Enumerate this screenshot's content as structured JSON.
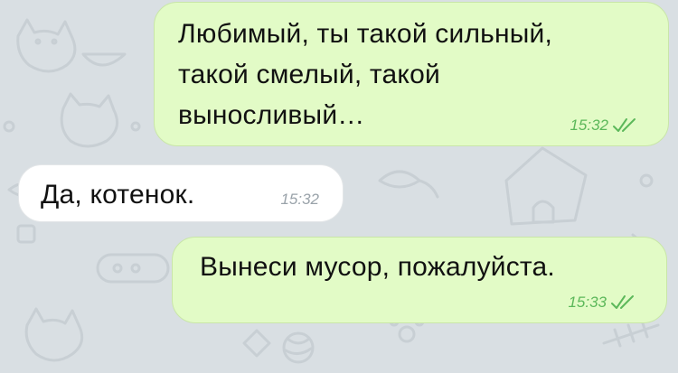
{
  "messages": [
    {
      "direction": "outgoing",
      "text": "Любимый, ты такой сильный,\nтакой смелый, такой\nвыносливый…",
      "time": "15:32",
      "status_icon": "double-check-icon"
    },
    {
      "direction": "incoming",
      "text": "Да, котенок.",
      "time": "15:32"
    },
    {
      "direction": "outgoing",
      "text": "Вынеси мусор, пожалуйста.",
      "time": "15:33",
      "status_icon": "double-check-icon"
    }
  ],
  "colors": {
    "outgoing_bubble": "#e2fbc6",
    "incoming_bubble": "#ffffff",
    "background": "#d9dfe3",
    "read_ticks": "#5cb85a"
  }
}
